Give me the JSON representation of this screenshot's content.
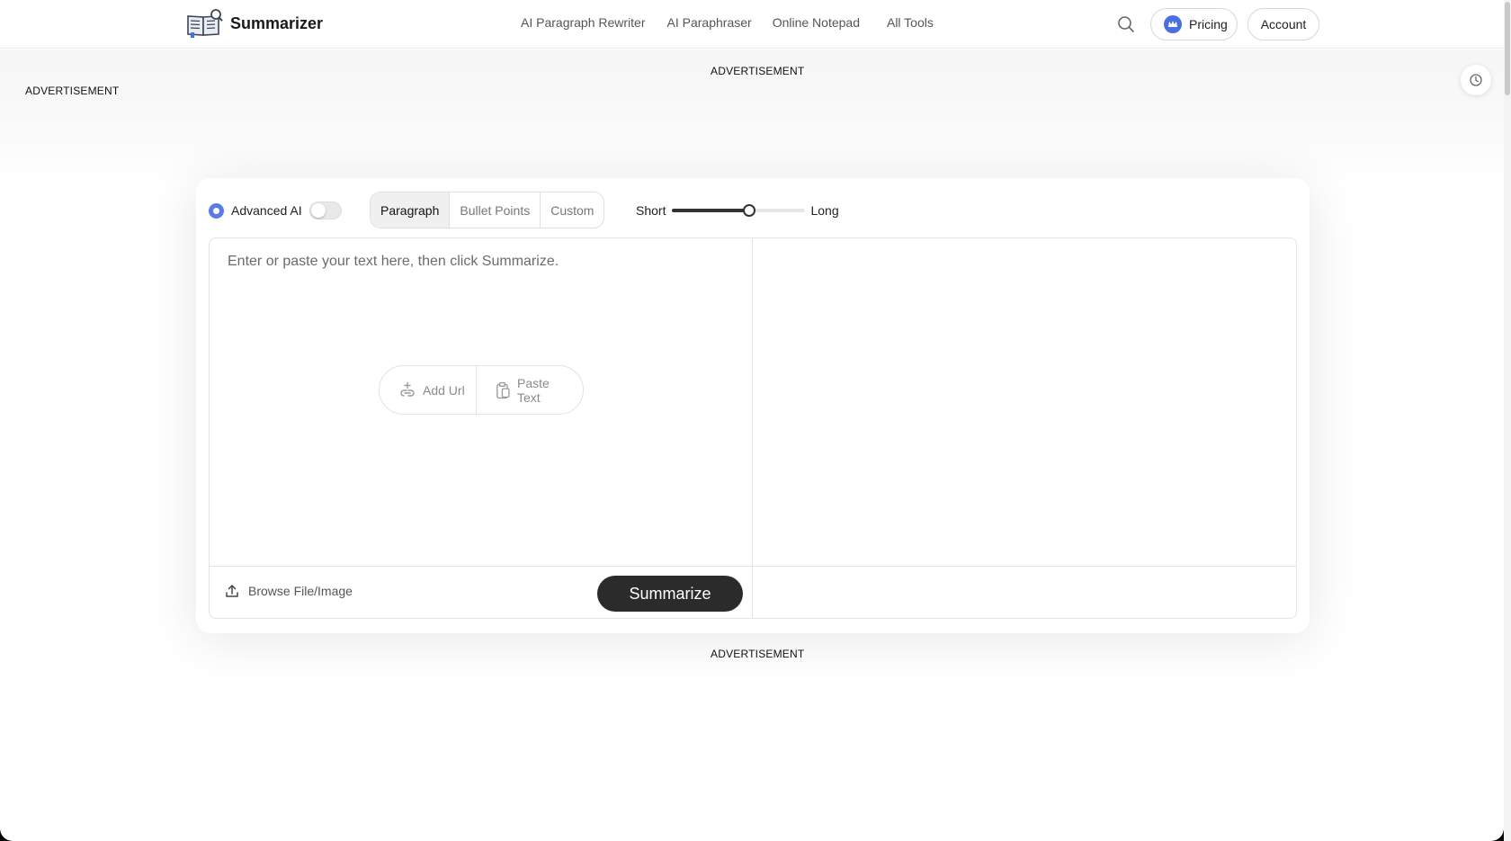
{
  "header": {
    "brand": "Summarizer",
    "nav": [
      "AI Paragraph Rewriter",
      "AI Paraphraser",
      "Online Notepad",
      "All Tools"
    ],
    "pricing_label": "Pricing",
    "account_label": "Account"
  },
  "ads": {
    "top_center": "ADVERTISEMENT",
    "top_left": "ADVERTISEMENT",
    "bottom_center": "ADVERTISEMENT"
  },
  "toolbar": {
    "advanced_ai_label": "Advanced AI",
    "advanced_ai_enabled": false,
    "modes": [
      "Paragraph",
      "Bullet Points",
      "Custom"
    ],
    "active_mode": "Paragraph",
    "length_min_label": "Short",
    "length_max_label": "Long",
    "length_value_fraction": 0.59
  },
  "editor": {
    "placeholder": "Enter or paste your text here, then click Summarize.",
    "add_url_label": "Add Url",
    "paste_text_label": "Paste Text",
    "browse_label": "Browse File/Image",
    "summarize_label": "Summarize"
  },
  "colors": {
    "accent": "#4a70e0",
    "primary_button": "#2b2b2b"
  }
}
